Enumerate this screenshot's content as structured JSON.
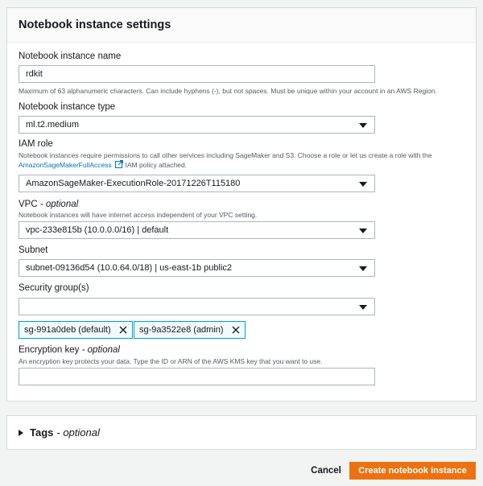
{
  "panel": {
    "title": "Notebook instance settings"
  },
  "name_field": {
    "label": "Notebook instance name",
    "value": "rdkit",
    "hint": "Maximum of 63 alphanumeric characters. Can include hyphens (-), but not spaces. Must be unique within your account in an AWS Region."
  },
  "type_field": {
    "label": "Notebook instance type",
    "value": "ml.t2.medium"
  },
  "iam_field": {
    "label": "IAM role",
    "desc_line1": "Notebook instances require permissions to call other services including SageMaker and S3. Choose a role or let us create a role with the",
    "desc_link": "AmazonSageMakerFullAccess",
    "desc_suffix": "IAM policy attached.",
    "value": "AmazonSageMaker-ExecutionRole-20171226T115180"
  },
  "vpc_field": {
    "label": "VPC",
    "optional": "- optional",
    "desc": "Notebook instances will have internet access independent of your VPC setting.",
    "value": "vpc-233e815b (10.0.0.0/16) | default"
  },
  "subnet_field": {
    "label": "Subnet",
    "value": "subnet-09136d54 (10.0.64.0/18) | us-east-1b public2"
  },
  "security_field": {
    "label": "Security group(s)",
    "value": "",
    "tokens": [
      "sg-991a0deb (default)",
      "sg-9a3522e8 (admin)"
    ]
  },
  "encryption_field": {
    "label": "Encryption key",
    "optional": "- optional",
    "desc": "An encryption key protects your data. Type the ID or ARN of the AWS KMS key that you want to use.",
    "value": ""
  },
  "tags": {
    "label": "Tags",
    "optional": "- optional"
  },
  "footer": {
    "cancel": "Cancel",
    "create": "Create notebook instance"
  },
  "colors": {
    "accent": "#ec7211",
    "link": "#0073bb",
    "token_border": "#00a1c9"
  }
}
